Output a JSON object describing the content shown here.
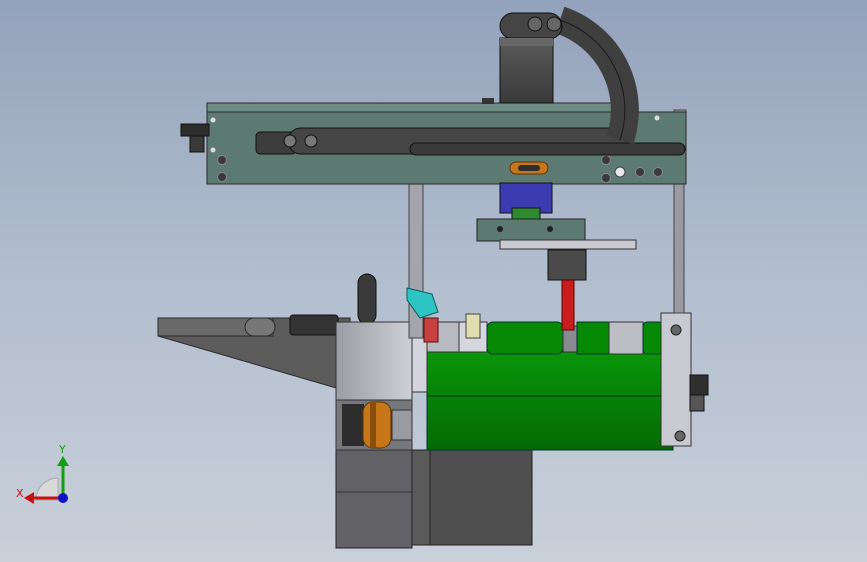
{
  "viewport": {
    "background_top": "#93a2bb",
    "background_bottom": "#c9d0da"
  },
  "colors": {
    "frame_plate": "#5d7a72",
    "dark_part": "#4a4a4a",
    "green_roller": "#058c05",
    "light_gray": "#c7c7d1",
    "blue_block": "#3c3cb0",
    "red_rod": "#c81e1e",
    "orange_pulley": "#c77619",
    "cyan_part": "#2fc4c4"
  },
  "triad": {
    "x_label": "X",
    "y_label": "Y",
    "x_color": "#c81010",
    "y_color": "#10a010",
    "z_color": "#1010c8",
    "icons": [
      "axis-triad-icon"
    ]
  }
}
